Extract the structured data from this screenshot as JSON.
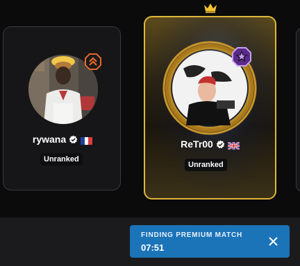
{
  "players": [
    {
      "name": "rywana",
      "rank": "Unranked",
      "flag": "flag-france",
      "verified": true,
      "rank_badge": "chevron-up-rank-badge"
    },
    {
      "name": "ReTr00",
      "rank": "Unranked",
      "flag": "flag-united-kingdom",
      "verified": true,
      "rank_badge": "star-rank-badge",
      "highlighted": true,
      "crown": "crown-icon"
    }
  ],
  "matchmaking": {
    "status": "FINDING PREMIUM MATCH",
    "timer": "07:51",
    "close_icon": "close-icon"
  },
  "colors": {
    "background": "#0b0b0c",
    "card": "#161618",
    "gold": "#e0b73a",
    "toast": "#1b73b8"
  }
}
